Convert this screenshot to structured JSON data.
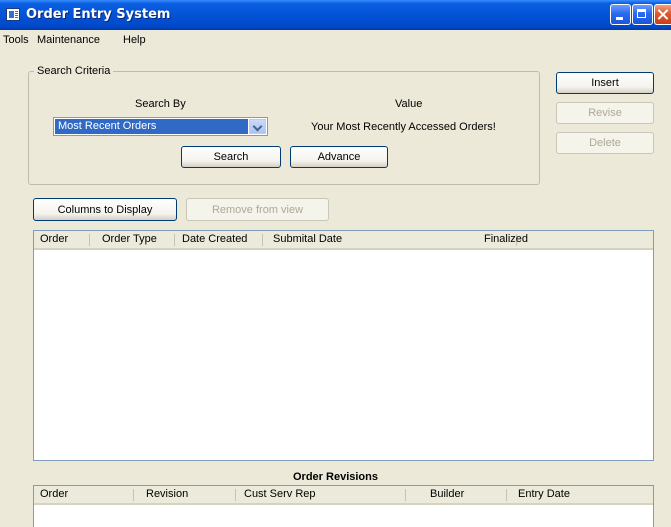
{
  "window": {
    "title": "Order Entry System"
  },
  "menu": [
    "Tools",
    "Maintenance",
    "Help"
  ],
  "search": {
    "group_label": "Search Criteria",
    "search_by_label": "Search By",
    "value_label": "Value",
    "selected_option": "Most Recent Orders",
    "value_text": "Your Most Recently Accessed Orders!",
    "search_button": "Search",
    "advance_button": "Advance"
  },
  "actions": {
    "insert": "Insert",
    "revise": "Revise",
    "delete": "Delete"
  },
  "columns_button": "Columns to Display",
  "remove_button": "Remove from view",
  "orders_table": {
    "columns": [
      "Order",
      "Order Type",
      "Date Created",
      "Submital Date",
      "Finalized"
    ]
  },
  "revisions": {
    "title": "Order Revisions",
    "columns": [
      "Order",
      "Revision",
      "Cust Serv Rep",
      "Builder",
      "Entry Date"
    ]
  }
}
